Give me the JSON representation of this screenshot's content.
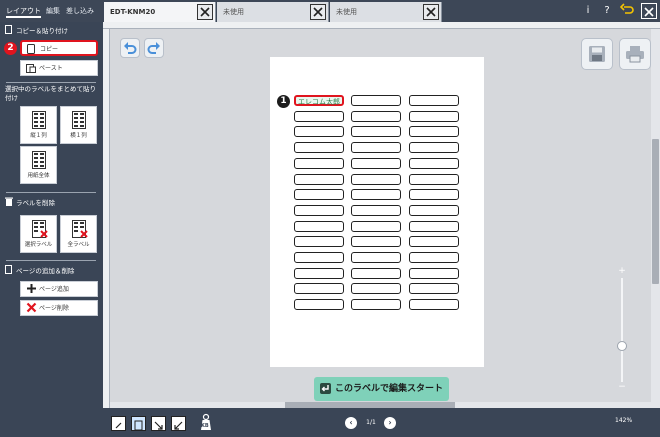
{
  "topbar": {
    "side_tabs": [
      "レイアウト",
      "編集",
      "差し込み"
    ],
    "doc_tabs": [
      {
        "label": "EDT-KNM20",
        "active": true
      },
      {
        "label": "未使用",
        "active": false
      },
      {
        "label": "未使用",
        "active": false
      }
    ],
    "info_icon": "i",
    "help_icon": "?"
  },
  "sidebar": {
    "copy_paste": {
      "title": "コピー＆貼り付け",
      "copy_label": "コピー",
      "paste_label": "ペースト"
    },
    "bulk_paste": {
      "title": "選択中のラベルをまとめて貼り付け",
      "buttons": [
        "縦１列",
        "横１列",
        "用紙全体"
      ]
    },
    "delete": {
      "title": "ラベルを削除",
      "buttons": [
        "選択ラベル",
        "全ラベル"
      ]
    },
    "pages": {
      "title": "ページの追加＆削除",
      "add_label": "ページ追加",
      "delete_label": "ページ削除"
    }
  },
  "canvas": {
    "first_label_text": "エレコム太郎",
    "start_button": "このラベルで編集スタート",
    "zoom_plus": "+",
    "zoom_minus": "−"
  },
  "badges": {
    "step1": "1",
    "step2": "2"
  },
  "bottombar": {
    "page_indicator": "1/1",
    "kb_label": "KB",
    "zoom_level": "142%"
  }
}
